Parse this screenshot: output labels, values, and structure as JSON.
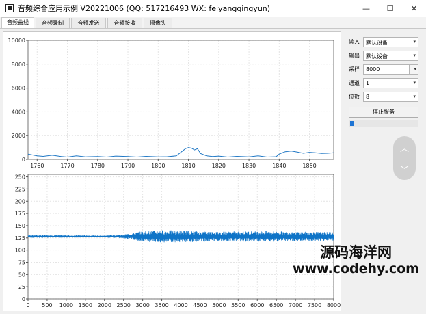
{
  "window": {
    "title": "音频综合应用示例 V20221006 (QQ: 517216493 WX: feiyangqingyun)",
    "minimize_glyph": "—",
    "maximize_glyph": "☐",
    "close_glyph": "✕"
  },
  "tabs": [
    {
      "label": "音频曲线",
      "active": true
    },
    {
      "label": "音频录制",
      "active": false
    },
    {
      "label": "音频发送",
      "active": false
    },
    {
      "label": "音频接收",
      "active": false
    },
    {
      "label": "摄像头",
      "active": false
    }
  ],
  "controls": {
    "input_label": "输入",
    "input_value": "默认设备",
    "output_label": "输出",
    "output_value": "默认设备",
    "samplerate_label": "采样",
    "samplerate_value": "8000",
    "channels_label": "通道",
    "channels_value": "1",
    "bits_label": "位数",
    "bits_value": "8",
    "stop_button": "停止服务",
    "progress": 0.05,
    "dropdown_glyph": "▾"
  },
  "scroll": {
    "up_glyph": "︿",
    "down_glyph": "﹀"
  },
  "watermark": {
    "line1": "源码海洋网",
    "line2": "www.codehy.com"
  },
  "chart_data": [
    {
      "type": "line",
      "yticks": [
        0,
        2000,
        4000,
        6000,
        8000,
        10000
      ],
      "ylim": [
        0,
        10000
      ],
      "xticks": [
        1760,
        1770,
        1780,
        1790,
        1800,
        1810,
        1820,
        1830,
        1840,
        1850
      ],
      "xlim": [
        1757,
        1858
      ],
      "grid": true,
      "color": "#1f77c4",
      "x": [
        1757,
        1760,
        1762,
        1765,
        1768,
        1770,
        1773,
        1776,
        1780,
        1783,
        1786,
        1790,
        1793,
        1796,
        1800,
        1803,
        1806,
        1808,
        1809,
        1810,
        1811,
        1812,
        1813,
        1814,
        1816,
        1818,
        1820,
        1823,
        1826,
        1830,
        1833,
        1836,
        1839,
        1840,
        1841,
        1842,
        1844,
        1846,
        1848,
        1850,
        1852,
        1854,
        1856,
        1858
      ],
      "values": [
        450,
        300,
        260,
        350,
        250,
        200,
        300,
        220,
        250,
        200,
        280,
        240,
        200,
        260,
        220,
        230,
        300,
        700,
        900,
        1000,
        950,
        800,
        900,
        500,
        300,
        250,
        280,
        200,
        260,
        220,
        300,
        200,
        230,
        450,
        550,
        650,
        700,
        620,
        520,
        600,
        560,
        500,
        520,
        560
      ]
    },
    {
      "type": "line",
      "yticks": [
        0,
        25,
        50,
        75,
        100,
        125,
        150,
        175,
        200,
        225,
        250
      ],
      "ylim": [
        0,
        255
      ],
      "xticks": [
        0,
        500,
        1000,
        1500,
        2000,
        2500,
        3000,
        3500,
        4000,
        4500,
        5000,
        5500,
        6000,
        6500,
        7000,
        7500,
        8000
      ],
      "xlim": [
        0,
        8000
      ],
      "grid": true,
      "color": "#0f74c7",
      "waveform_center": 128,
      "envelope": [
        {
          "x": 0,
          "amp": 3
        },
        {
          "x": 2000,
          "amp": 2
        },
        {
          "x": 2500,
          "amp": 4
        },
        {
          "x": 3000,
          "amp": 11
        },
        {
          "x": 3500,
          "amp": 13
        },
        {
          "x": 4000,
          "amp": 12
        },
        {
          "x": 5000,
          "amp": 10
        },
        {
          "x": 6000,
          "amp": 11
        },
        {
          "x": 7000,
          "amp": 10
        },
        {
          "x": 8000,
          "amp": 9
        }
      ]
    }
  ]
}
